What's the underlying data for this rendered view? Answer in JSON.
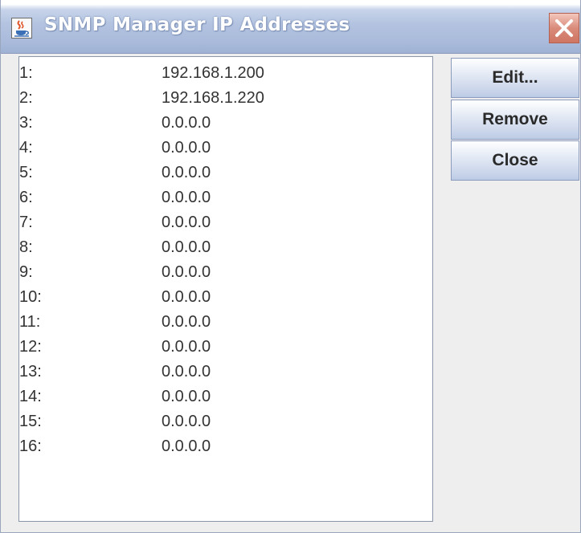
{
  "window": {
    "title": "SNMP Manager IP Addresses"
  },
  "icons": {
    "app": "java-cup-icon",
    "close": "close-icon"
  },
  "colors": {
    "titlebar": "#b3c3e0",
    "close_button": "#d98b7a",
    "background": "#eeeeee"
  },
  "list": {
    "items": [
      {
        "index": "1:",
        "ip": "192.168.1.200"
      },
      {
        "index": "2:",
        "ip": "192.168.1.220"
      },
      {
        "index": "3:",
        "ip": "0.0.0.0"
      },
      {
        "index": "4:",
        "ip": "0.0.0.0"
      },
      {
        "index": "5:",
        "ip": "0.0.0.0"
      },
      {
        "index": "6:",
        "ip": "0.0.0.0"
      },
      {
        "index": "7:",
        "ip": "0.0.0.0"
      },
      {
        "index": "8:",
        "ip": "0.0.0.0"
      },
      {
        "index": "9:",
        "ip": "0.0.0.0"
      },
      {
        "index": "10:",
        "ip": "0.0.0.0"
      },
      {
        "index": "11:",
        "ip": "0.0.0.0"
      },
      {
        "index": "12:",
        "ip": "0.0.0.0"
      },
      {
        "index": "13:",
        "ip": "0.0.0.0"
      },
      {
        "index": "14:",
        "ip": "0.0.0.0"
      },
      {
        "index": "15:",
        "ip": "0.0.0.0"
      },
      {
        "index": "16:",
        "ip": "0.0.0.0"
      }
    ]
  },
  "buttons": {
    "edit": "Edit...",
    "remove": "Remove",
    "close": "Close"
  }
}
